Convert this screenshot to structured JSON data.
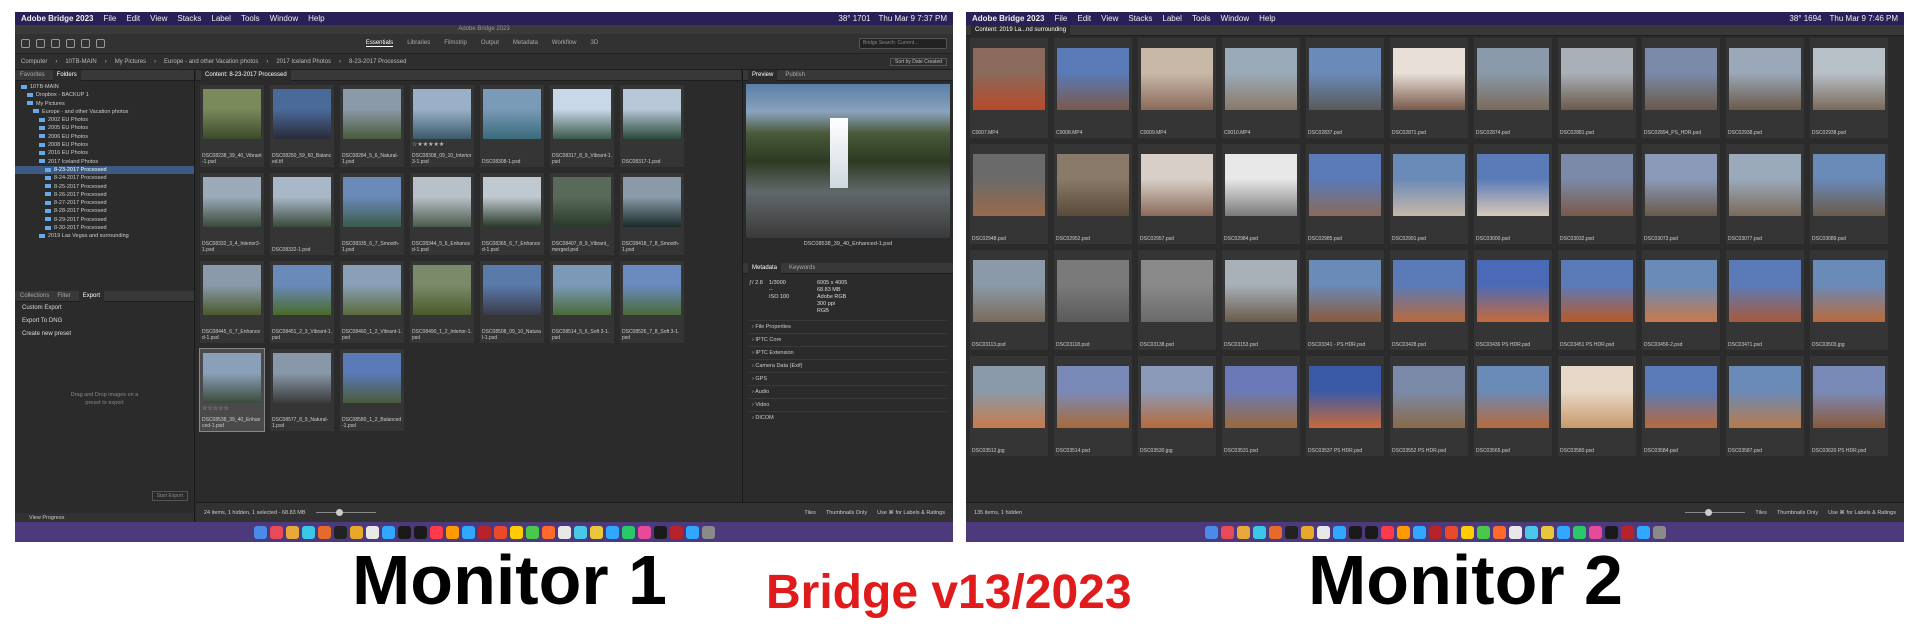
{
  "monitor1": {
    "menubar": {
      "items": [
        "Adobe Bridge 2023",
        "File",
        "Edit",
        "View",
        "Stacks",
        "Label",
        "Tools",
        "Window",
        "Help"
      ],
      "right": [
        "38° 1701",
        "Thu Mar 9  7:37 PM"
      ]
    },
    "title": "Adobe Bridge 2023",
    "workspaces": [
      "Essentials",
      "Libraries",
      "Filmstrip",
      "Output",
      "Metadata",
      "Workflow",
      "3D"
    ],
    "search_placeholder": "Bridge Search: Current...",
    "path": [
      "Computer",
      "10TB-MAIN",
      "My Pictures",
      "Europe - and other Vacation photos",
      "2017 Iceland Photos",
      "8-23-2017 Processed"
    ],
    "sort": "Sort by Date Created",
    "left_tabs": [
      "Favorites",
      "Folders"
    ],
    "tree": [
      {
        "label": "10TB-MAIN",
        "sel": false,
        "indent": 1
      },
      {
        "label": "Dropbox - BACKUP 1",
        "sel": false,
        "indent": 2
      },
      {
        "label": "My Pictures",
        "sel": false,
        "indent": 2
      },
      {
        "label": "Europe - and other Vacation photos",
        "sel": false,
        "indent": 3
      },
      {
        "label": "2002 EU Photos",
        "sel": false,
        "indent": 4
      },
      {
        "label": "2005 EU Photos",
        "sel": false,
        "indent": 4
      },
      {
        "label": "2006 EU Photos",
        "sel": false,
        "indent": 4
      },
      {
        "label": "2008 EU Photos",
        "sel": false,
        "indent": 4
      },
      {
        "label": "2016 EU Photos",
        "sel": false,
        "indent": 4
      },
      {
        "label": "2017 Iceland Photos",
        "sel": false,
        "indent": 4
      },
      {
        "label": "8-23-2017 Processed",
        "sel": true,
        "indent": 5
      },
      {
        "label": "8-24-2017 Processed",
        "sel": false,
        "indent": 5
      },
      {
        "label": "8-25-2017 Processed",
        "sel": false,
        "indent": 5
      },
      {
        "label": "8-26-2017 Processed",
        "sel": false,
        "indent": 5
      },
      {
        "label": "8-27-2017 Processed",
        "sel": false,
        "indent": 5
      },
      {
        "label": "8-28-2017 Processed",
        "sel": false,
        "indent": 5
      },
      {
        "label": "8-29-2017 Processed",
        "sel": false,
        "indent": 5
      },
      {
        "label": "8-30-2017 Processed",
        "sel": false,
        "indent": 5
      },
      {
        "label": "2019 Las Vegas and surrounding",
        "sel": false,
        "indent": 4
      }
    ],
    "bottom_tabs": [
      "Collections",
      "Filter",
      "Export"
    ],
    "export_items": [
      "Custom Export",
      "Export To DNG",
      "Create new preset"
    ],
    "drop_text": [
      "Drag and Drop images on a",
      "preset to export"
    ],
    "start_export": "Start Export",
    "view_progress": "View Progress",
    "content_title": "Content: 8-23-2017 Processed",
    "thumbs": [
      {
        "name": "DSC08238_39_40_Vibrant-1.psd",
        "stars": "",
        "sel": false,
        "c1": "#7a8a5a",
        "c2": "#3c4a2c"
      },
      {
        "name": "DSC08250_59_60_Balanced.tif",
        "stars": "",
        "sel": false,
        "c1": "#4a6a9a",
        "c2": "#2a2a3a"
      },
      {
        "name": "DSC08284_5_6_Natural-1.psd",
        "stars": "",
        "sel": false,
        "c1": "#8a9aa8",
        "c2": "#4a5a3a"
      },
      {
        "name": "DSC08308_09_10_Interior3-1.psd",
        "stars": "☆★★★★★",
        "sel": false,
        "c1": "#9ab0c8",
        "c2": "#3a5a6a"
      },
      {
        "name": "DSC08308-1.psd",
        "stars": "",
        "sel": false,
        "c1": "#7a9ab8",
        "c2": "#3a6a7a"
      },
      {
        "name": "DSC08317_8_9_Vibrant-1.psd",
        "stars": "",
        "sel": false,
        "c1": "#c8d8e8",
        "c2": "#3a5a4a"
      },
      {
        "name": "DSC08317-1.psd",
        "stars": "",
        "sel": false,
        "c1": "#b8c8d8",
        "c2": "#2a4a3a"
      },
      {
        "name": "DSC08332_3_4_Interior3-1.psd",
        "stars": "",
        "sel": false,
        "c1": "#9aaab8",
        "c2": "#3a4a3a"
      },
      {
        "name": "DSC08332-1.psd",
        "stars": "",
        "sel": false,
        "c1": "#a8b8c8",
        "c2": "#3a4a3a"
      },
      {
        "name": "DSC08335_6_7_Smooth-1.psd",
        "stars": "",
        "sel": false,
        "c1": "#6a8ab8",
        "c2": "#3a5a4a"
      },
      {
        "name": "DSC08344_5_6_Enhanced-1.psd",
        "stars": "",
        "sel": false,
        "c1": "#b8c0c8",
        "c2": "#4a5a4a"
      },
      {
        "name": "DSC08365_6_7_Enhanced-1.psd",
        "stars": "",
        "sel": false,
        "c1": "#c0c8d0",
        "c2": "#2a3a2a"
      },
      {
        "name": "DSC08407_8_9_Vibrant_merged.psd",
        "stars": "",
        "sel": false,
        "c1": "#5a6a5a",
        "c2": "#2a3a2a"
      },
      {
        "name": "DSC08418_7_8_Smooth-1.psd",
        "stars": "",
        "sel": false,
        "c1": "#8a9aa8",
        "c2": "#1a2a2a"
      },
      {
        "name": "DSC08445_6_7_Enhanced-1.psd",
        "stars": "",
        "sel": false,
        "c1": "#8a9aaa",
        "c2": "#4a5a2a"
      },
      {
        "name": "DSC08451_2_3_Vibrant-1.psd",
        "stars": "",
        "sel": false,
        "c1": "#6a8aba",
        "c2": "#4a6a2a"
      },
      {
        "name": "DSC08460_1_2_Vibrant-1.psd",
        "stars": "",
        "sel": false,
        "c1": "#8aa0b8",
        "c2": "#5a6a3a"
      },
      {
        "name": "DSC08490_1_2_Interior-1.psd",
        "stars": "",
        "sel": false,
        "c1": "#7a8a6a",
        "c2": "#4a5a2a"
      },
      {
        "name": "DSC08508_09_10_Natural-1.psd",
        "stars": "",
        "sel": false,
        "c1": "#5a7aaa",
        "c2": "#3a3a4a"
      },
      {
        "name": "DSC08514_5_6_Soft 3-1.psd",
        "stars": "",
        "sel": false,
        "c1": "#7a9ab8",
        "c2": "#4a6a3a"
      },
      {
        "name": "DSC08526_7_8_Soft 3-1.psd",
        "stars": "",
        "sel": false,
        "c1": "#6a8ac0",
        "c2": "#4a6a3a"
      },
      {
        "name": "DSC08538_39_40_Enhanced-1.psd",
        "stars": "☆☆☆☆☆",
        "sel": true,
        "c1": "#8aa0b8",
        "c2": "#3a4a3a"
      },
      {
        "name": "DSC08577_8_9_Natural-1.psd",
        "stars": "",
        "sel": false,
        "c1": "#8898a8",
        "c2": "#3a3a3a"
      },
      {
        "name": "DSC08580_1_2_Balanced-1.psd",
        "stars": "",
        "sel": false,
        "c1": "#5a7ab8",
        "c2": "#4a5a3a"
      }
    ],
    "preview_tabs": [
      "Preview",
      "Publish"
    ],
    "preview_name": "DSC08538_39_40_Enhanced-1.psd",
    "meta_tabs": [
      "Metadata",
      "Keywords"
    ],
    "meta": [
      [
        "ƒ/ 2.8",
        "1/3000",
        "6005 x 4005"
      ],
      [
        "",
        "--",
        "68.83 MB",
        "300 ppi"
      ],
      [
        "",
        "ISO 100",
        "Adobe RGB",
        "RGB"
      ]
    ],
    "meta_sections": [
      "File Properties",
      "IPTC Core",
      "IPTC Extension",
      "Camera Data (Exif)",
      "GPS",
      "Audio",
      "Video",
      "DICOM"
    ],
    "status": "24 items, 1 hidden, 1 selected - 68.83 MB",
    "status_opts": [
      "Tiles",
      "Thumbnails Only",
      "Use ⌘ for Labels & Ratings"
    ]
  },
  "monitor2": {
    "menubar": {
      "items": [
        "Adobe Bridge 2023",
        "File",
        "Edit",
        "View",
        "Stacks",
        "Label",
        "Tools",
        "Window",
        "Help"
      ],
      "right": [
        "38° 1694",
        "Thu Mar 9  7:46 PM"
      ]
    },
    "content_title": "Content: 2019 La...nd surrounding",
    "thumbs": [
      {
        "name": "C0007.MP4",
        "c1": "#8a6a5a",
        "c2": "#b84a2a"
      },
      {
        "name": "C0008.MP4",
        "c1": "#5a7ab8",
        "c2": "#7a5a4a"
      },
      {
        "name": "C0009.MP4",
        "c1": "#c8b8a8",
        "c2": "#8a6a5a"
      },
      {
        "name": "C0010.MP4",
        "c1": "#9aaab8",
        "c2": "#8a7a6a"
      },
      {
        "name": "DSC02837.psd",
        "c1": "#6a8aba",
        "c2": "#5a5a5a"
      },
      {
        "name": "DSC02871.psd",
        "c1": "#e8e0d8",
        "c2": "#7a5a4a"
      },
      {
        "name": "DSC02874.psd",
        "c1": "#8a9aaa",
        "c2": "#7a6a5a"
      },
      {
        "name": "DSC02881.psd",
        "c1": "#aab0b8",
        "c2": "#6a5a4a"
      },
      {
        "name": "DSC02894_PS_HDR.psd",
        "c1": "#7a8aa8",
        "c2": "#6a5a4a"
      },
      {
        "name": "DSC02938.psd",
        "c1": "#9aa8b8",
        "c2": "#6a5a4a"
      },
      {
        "name": "DSC02938.psd",
        "c1": "#b8c0c8",
        "c2": "#7a6a5a"
      },
      {
        "name": "DSC02948.psd",
        "c1": "#6a6a6a",
        "c2": "#9a6a4a"
      },
      {
        "name": "DSC02952.psd",
        "c1": "#8a7a6a",
        "c2": "#5a4a3a"
      },
      {
        "name": "DSC02957.psd",
        "c1": "#d8d0c8",
        "c2": "#8a6a5a"
      },
      {
        "name": "DSC02984.psd",
        "c1": "#e8e8e8",
        "c2": "#7a7a7a"
      },
      {
        "name": "DSC02985.psd",
        "c1": "#5a7ab8",
        "c2": "#8a6a5a"
      },
      {
        "name": "DSC02991.psd",
        "c1": "#6a8ab8",
        "c2": "#c8b8a8"
      },
      {
        "name": "DSC03000.psd",
        "c1": "#5a7ab8",
        "c2": "#d8c8b8"
      },
      {
        "name": "DSC03032.psd",
        "c1": "#7a8aa8",
        "c2": "#7a5a4a"
      },
      {
        "name": "DSC03073.psd",
        "c1": "#8a9ab8",
        "c2": "#6a5a4a"
      },
      {
        "name": "DSC03077.psd",
        "c1": "#9aaabb",
        "c2": "#7a6a5a"
      },
      {
        "name": "DSC03089.psd",
        "c1": "#6a8ab8",
        "c2": "#6a5a4a"
      },
      {
        "name": "DSC03113.psd",
        "c1": "#8a9aa8",
        "c2": "#7a6a5a"
      },
      {
        "name": "DSC03118.psd",
        "c1": "#7a7a7a",
        "c2": "#5a5a5a"
      },
      {
        "name": "DSC03138.psd",
        "c1": "#8a8a8a",
        "c2": "#6a6a6a"
      },
      {
        "name": "DSC03153.psd",
        "c1": "#a8b0b8",
        "c2": "#6a5a4a"
      },
      {
        "name": "DSC03341 - PS HDR.psd",
        "c1": "#6a8ab8",
        "c2": "#8a5a3a"
      },
      {
        "name": "DSC03428.psd",
        "c1": "#5a7ab8",
        "c2": "#b86a3a"
      },
      {
        "name": "DSC03436 PS HDR.psd",
        "c1": "#4a6ab8",
        "c2": "#c86a3a"
      },
      {
        "name": "DSC03451 PS HDR.psd",
        "c1": "#5a7ab8",
        "c2": "#b85a2a"
      },
      {
        "name": "DSC03456-2.psd",
        "c1": "#6a8ab8",
        "c2": "#c87a4a"
      },
      {
        "name": "DSC03471.psd",
        "c1": "#5a7ab8",
        "c2": "#a85a3a"
      },
      {
        "name": "DSC03503.jpg",
        "c1": "#6a8ab8",
        "c2": "#b86a3a"
      },
      {
        "name": "DSC03512.jpg",
        "c1": "#8a9aaa",
        "c2": "#c87a4a"
      },
      {
        "name": "DSC03514.psd",
        "c1": "#7a8ab8",
        "c2": "#a86a3a"
      },
      {
        "name": "DSC03530.jpg",
        "c1": "#8a9ab8",
        "c2": "#b86a3a"
      },
      {
        "name": "DSC03531.psd",
        "c1": "#6a7ab8",
        "c2": "#9a6a3a"
      },
      {
        "name": "DSC03537 PS HDR.psd",
        "c1": "#3a5aa8",
        "c2": "#c86a3a"
      },
      {
        "name": "DSC03552 PS HDR.psd",
        "c1": "#7a8aa8",
        "c2": "#8a6a4a"
      },
      {
        "name": "DSC03565.psd",
        "c1": "#6a8ab8",
        "c2": "#b86a3a"
      },
      {
        "name": "DSC03580.psd",
        "c1": "#e8d8c8",
        "c2": "#c89a6a"
      },
      {
        "name": "DSC03584.psd",
        "c1": "#5a7ab8",
        "c2": "#b86a3a"
      },
      {
        "name": "DSC03587.psd",
        "c1": "#6a8ab8",
        "c2": "#b87a4a"
      },
      {
        "name": "DSC03620 PS HDR.psd",
        "c1": "#7a8ab8",
        "c2": "#8a5a3a"
      }
    ],
    "status": "135 items, 1 hidden",
    "status_opts": [
      "Tiles",
      "Thumbnails Only",
      "Use ⌘ for Labels & Ratings"
    ]
  },
  "captions": {
    "left": "Monitor 1",
    "center": "Bridge v13/2023",
    "right": "Monitor 2"
  },
  "dock_colors": [
    "#4a8ae8",
    "#e84a5a",
    "#e8a83a",
    "#3ac8e8",
    "#e86a2a",
    "#222",
    "#e8a82a",
    "#e8e8e8",
    "#31a8ff",
    "#1a1a1a",
    "#1a1a1a",
    "#ff3a4a",
    "#ff9a00",
    "#31a8ff",
    "#b8232a",
    "#e84a2a",
    "#ffcc00",
    "#4ac84a",
    "#ff6a2a",
    "#e8e8e8",
    "#4ac8e8",
    "#e8c83a",
    "#31a8ff",
    "#2ac86a",
    "#e84a9a",
    "#1a1a1a",
    "#b8232a",
    "#31a8ff",
    "#8a8a8a"
  ]
}
